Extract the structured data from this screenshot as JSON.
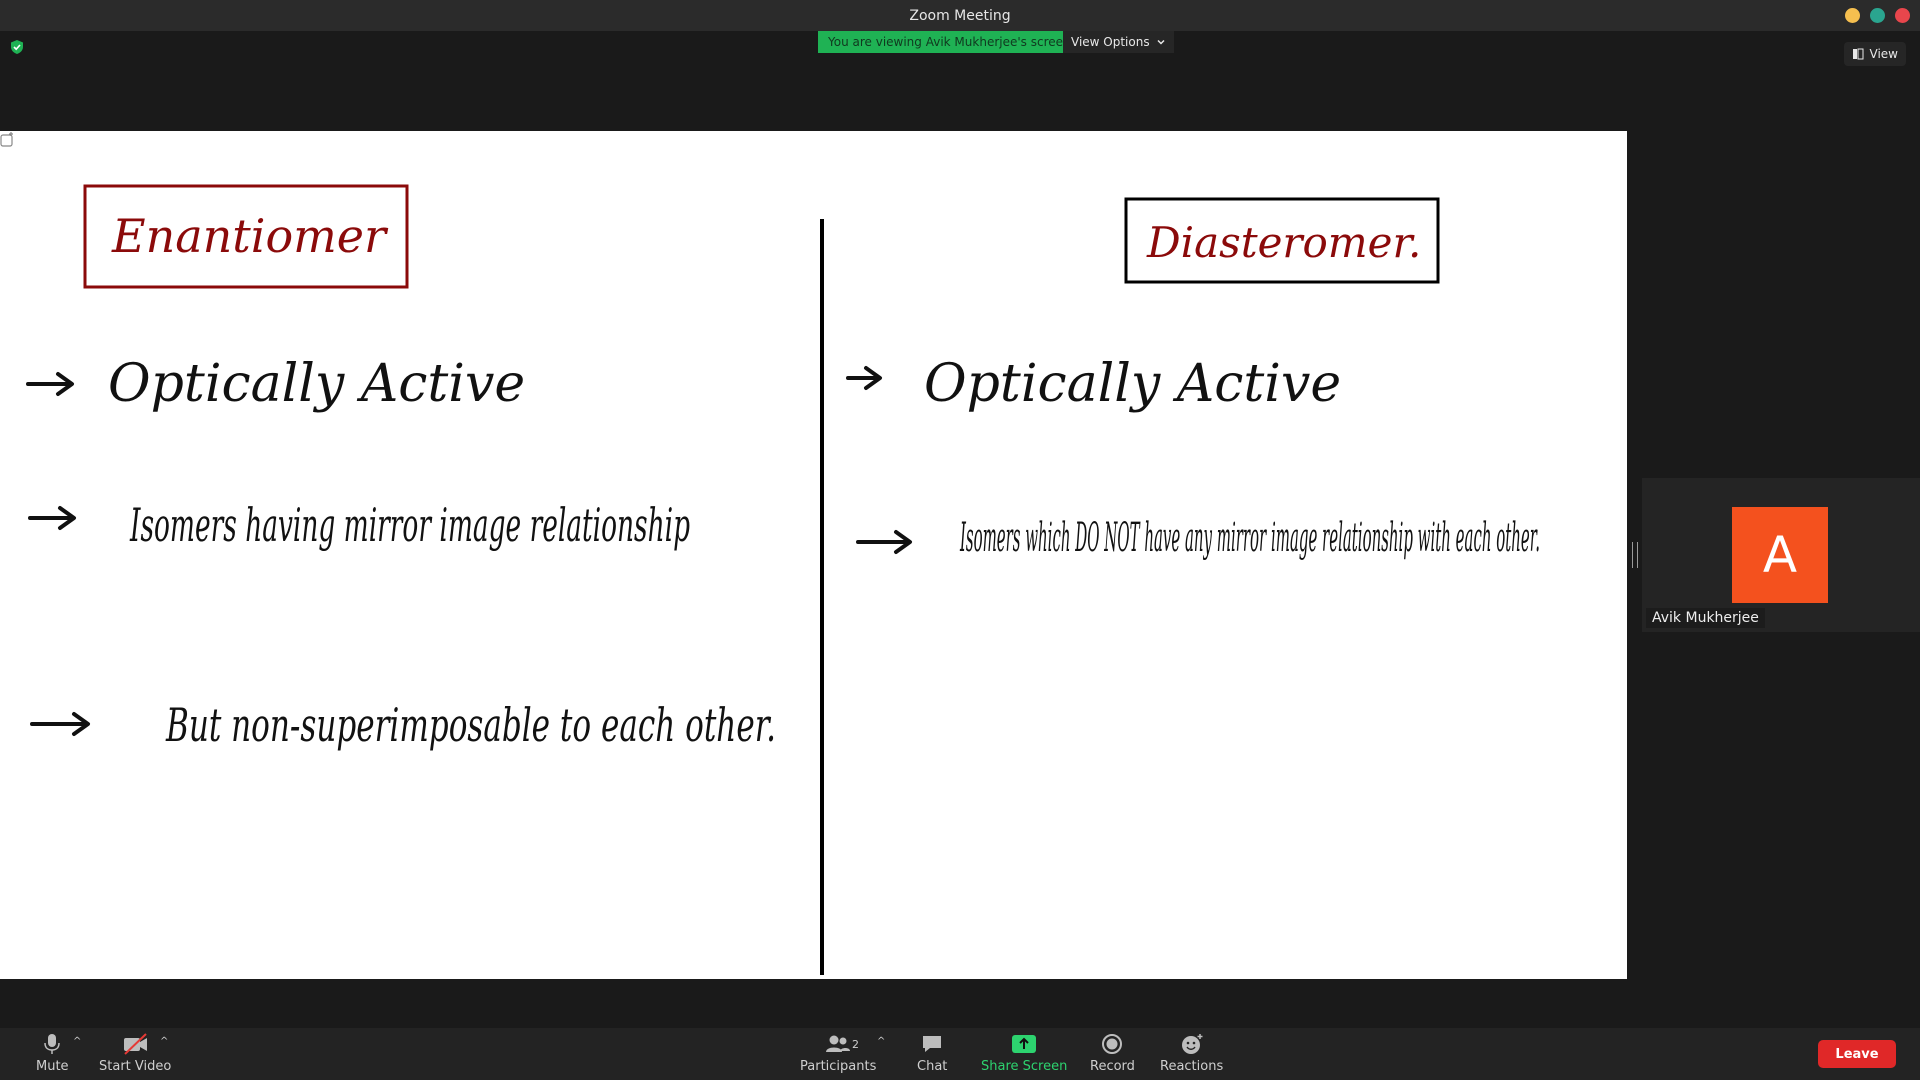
{
  "window": {
    "title": "Zoom Meeting",
    "controls": [
      {
        "name": "minimize",
        "color": "#f5bf4f"
      },
      {
        "name": "maximize",
        "color": "#2aa58f"
      },
      {
        "name": "close",
        "color": "#e8464c"
      }
    ]
  },
  "banner": {
    "text": "You are viewing Avik Mukherjee's screen",
    "color": "#1fb254"
  },
  "view_options": {
    "label": "View Options"
  },
  "view_button": {
    "label": "View"
  },
  "shared_screen": {
    "left_heading": "Enantiomer",
    "right_heading": "Diasteromer.",
    "heading_color": "#8b0a0a",
    "left_points": [
      "Optically Active",
      "Isomers having mirror image relationship",
      "But non-superimposable to each other."
    ],
    "right_points": [
      "Optically Active",
      "Isomers which DO NOT have any mirror image relationship with each other."
    ]
  },
  "participant": {
    "name": "Avik Mukherjee",
    "initial": "A",
    "avatar_color": "#f4511e"
  },
  "toolbar": {
    "mute": "Mute",
    "start_video": "Start Video",
    "participants": "Participants",
    "participants_count": "2",
    "chat": "Chat",
    "share_screen": "Share Screen",
    "record": "Record",
    "reactions": "Reactions",
    "leave": "Leave",
    "share_color": "#2dd36f",
    "leave_color": "#e02828"
  }
}
